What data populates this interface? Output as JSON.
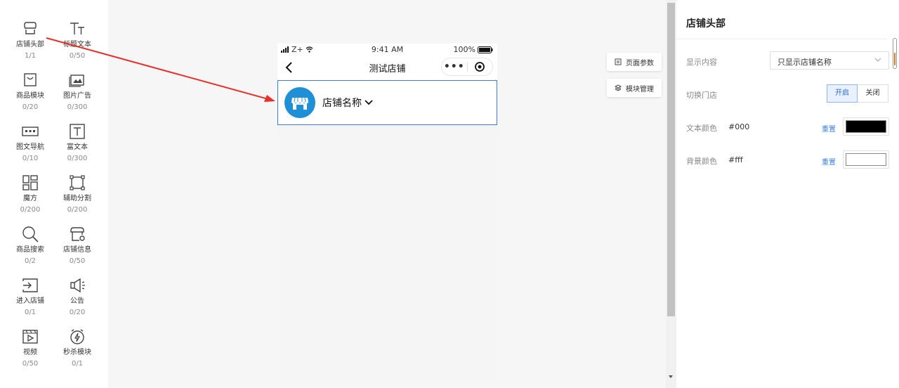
{
  "palette": {
    "items": [
      {
        "label": "店铺头部",
        "count": "1/1",
        "icon": "storefront-header-icon"
      },
      {
        "label": "标题文本",
        "count": "0/50",
        "icon": "title-text-icon"
      },
      {
        "label": "商品模块",
        "count": "0/20",
        "icon": "shopping-bag-icon"
      },
      {
        "label": "图片广告",
        "count": "0/300",
        "icon": "image-ad-icon"
      },
      {
        "label": "图文导航",
        "count": "0/10",
        "icon": "image-nav-icon"
      },
      {
        "label": "富文本",
        "count": "0/300",
        "icon": "rich-text-icon"
      },
      {
        "label": "魔方",
        "count": "0/200",
        "icon": "grid-cube-icon"
      },
      {
        "label": "辅助分割",
        "count": "0/200",
        "icon": "divider-icon"
      },
      {
        "label": "商品搜索",
        "count": "0/2",
        "icon": "search-icon"
      },
      {
        "label": "店铺信息",
        "count": "0/50",
        "icon": "store-info-icon"
      },
      {
        "label": "进入店铺",
        "count": "0/1",
        "icon": "enter-store-icon"
      },
      {
        "label": "公告",
        "count": "0/20",
        "icon": "megaphone-icon"
      },
      {
        "label": "视频",
        "count": "0/50",
        "icon": "video-icon"
      },
      {
        "label": "秒杀模块",
        "count": "0/1",
        "icon": "flash-sale-icon"
      }
    ]
  },
  "phone": {
    "status": {
      "carrier": "Z+",
      "time": "9:41 AM",
      "battery": "100%"
    },
    "nav_title": "测试店铺",
    "more_label": "•••",
    "shop_name": "店铺名称"
  },
  "canvas_buttons": {
    "page_params": "页面参数",
    "module_manage": "模块管理"
  },
  "panel": {
    "title": "店铺头部",
    "display_content": {
      "label": "显示内容",
      "value": "只显示店铺名称"
    },
    "switch_store": {
      "label": "切换门店",
      "on": "开启",
      "off": "关闭"
    },
    "text_color": {
      "label": "文本颜色",
      "value": "#000",
      "reset": "重置",
      "swatch": "#000000"
    },
    "bg_color": {
      "label": "背景颜色",
      "value": "#fff",
      "reset": "重置",
      "swatch": "#ffffff"
    }
  },
  "colors": {
    "accent": "#3b7ddd",
    "annotation_arrow": "#e8302a",
    "shop_logo": "#1f8fd6"
  }
}
